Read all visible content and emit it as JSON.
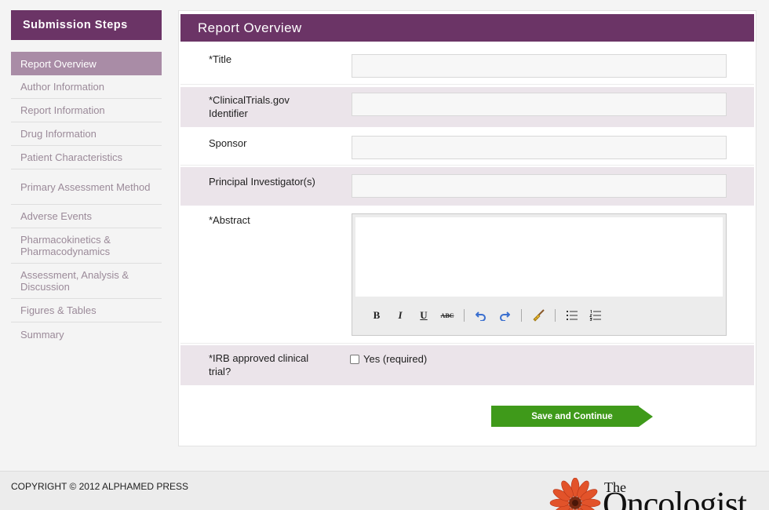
{
  "sidebar": {
    "title": "Submission Steps",
    "items": [
      {
        "label": "Report Overview",
        "active": true
      },
      {
        "label": "Author Information"
      },
      {
        "label": "Report Information"
      },
      {
        "label": "Drug Information"
      },
      {
        "label": "Patient Characteristics"
      },
      {
        "label": "Primary Assessment Method"
      },
      {
        "label": "Adverse Events"
      },
      {
        "label": "Pharmacokinetics & Pharmacodynamics"
      },
      {
        "label": "Assessment, Analysis & Discussion"
      },
      {
        "label": "Figures & Tables"
      },
      {
        "label": "Summary"
      }
    ]
  },
  "form": {
    "header": "Report Overview",
    "fields": {
      "title": {
        "label": "*Title",
        "value": ""
      },
      "clinicaltrials": {
        "label": "*ClinicalTrials.gov Identifier",
        "value": ""
      },
      "sponsor": {
        "label": "Sponsor",
        "value": ""
      },
      "pi": {
        "label": "Principal Investigator(s)",
        "value": ""
      },
      "abstract": {
        "label": "*Abstract",
        "value": ""
      },
      "irb": {
        "label": "*IRB approved clinical trial?",
        "checkbox_label": "Yes (required)",
        "checked": false
      }
    },
    "toolbar": {
      "bold": "B",
      "italic": "I",
      "underline": "U",
      "strike": "ABC"
    },
    "save_label": "Save and Continue"
  },
  "footer": {
    "copyright": "COPYRIGHT © 2012 ALPHAMED PRESS",
    "logo_the": "The",
    "logo_name": "Oncologist"
  },
  "colors": {
    "brand_purple": "#6b3466",
    "active_step": "#a98ca6",
    "inactive_step_text": "#9b8a99",
    "shaded_row": "#ebe4ea",
    "save_green": "#3f9a1a"
  }
}
